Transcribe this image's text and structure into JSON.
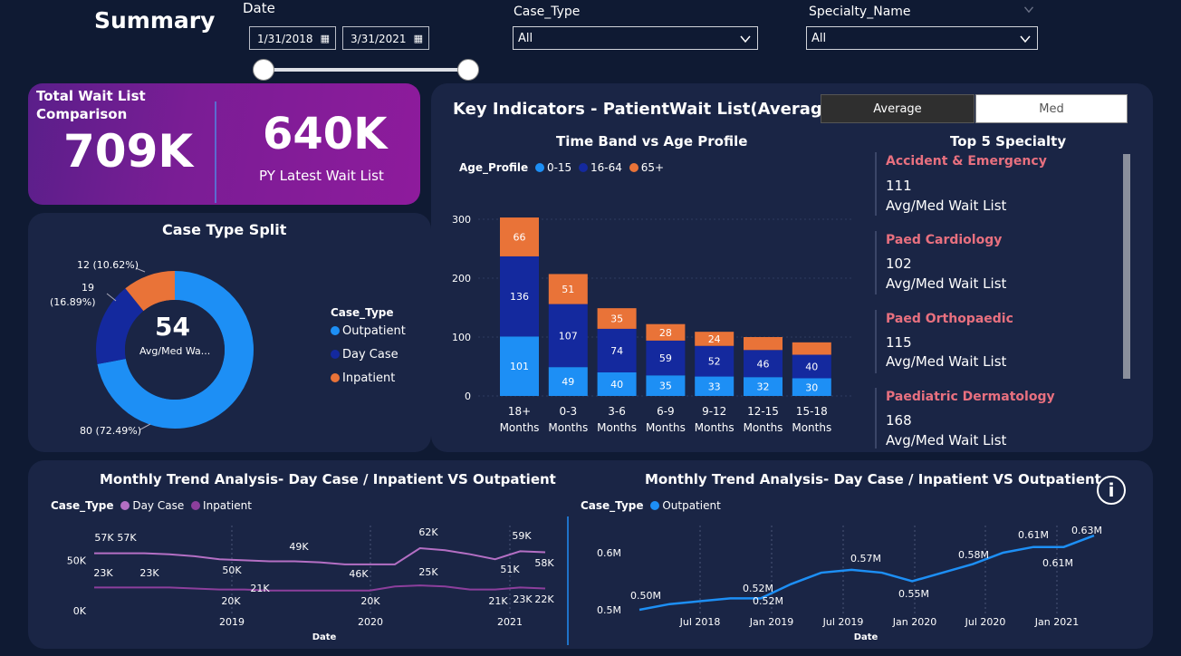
{
  "header": {
    "title": "Summary",
    "date_label": "Date",
    "date_start": "1/31/2018",
    "date_end": "3/31/2021",
    "case_type_label": "Case_Type",
    "case_type_value": "All",
    "specialty_label": "Specialty_Name",
    "specialty_value": "All"
  },
  "kpi": {
    "title_line1": "Total Wait List",
    "title_line2": "Comparison",
    "current_value": "709K",
    "py_value": "640K",
    "py_label": "PY Latest Wait List"
  },
  "toggle": {
    "average": "Average",
    "median": "Med"
  },
  "key_indicators_title": "Key Indicators - PatientWait List(Average)",
  "case_split": {
    "title": "Case Type Split",
    "center_value": "54",
    "center_label": "Avg/Med Wa...",
    "legend_title": "Case_Type",
    "labels": {
      "outpatient": "80 (72.49%)",
      "daycase_line1": "19",
      "daycase_line2": "(16.89%)",
      "inpatient": "12 (10.62%)"
    },
    "colors": {
      "outpatient": "#1d8ff5",
      "daycase": "#14299e",
      "inpatient": "#e97338"
    }
  },
  "time_band": {
    "title": "Time Band vs Age Profile",
    "legend_title": "Age_Profile",
    "y_ticks": [
      "300",
      "200",
      "100",
      "0"
    ],
    "colors": {
      "a": "#1d8ff5",
      "b": "#14299e",
      "c": "#e97338"
    }
  },
  "top5": {
    "title": "Top 5 Specialty",
    "items": [
      {
        "name": "Accident & Emergency",
        "value": "111",
        "label": "Avg/Med Wait List"
      },
      {
        "name": "Paed Cardiology",
        "value": "102",
        "label": "Avg/Med Wait List"
      },
      {
        "name": "Paed Orthopaedic",
        "value": "115",
        "label": "Avg/Med Wait List"
      },
      {
        "name": "Paediatric Dermatology",
        "value": "168",
        "label": "Avg/Med Wait List"
      }
    ]
  },
  "trend_left": {
    "title": "Monthly Trend Analysis- Day Case / Inpatient VS Outpatient",
    "legend_title": "Case_Type",
    "y_ticks": [
      "50K",
      "0K"
    ],
    "x_ticks": [
      "2019",
      "2020",
      "2021"
    ],
    "xlabel": "Date",
    "color_daycase": "#b46fc4",
    "color_inpatient": "#8c3f9c",
    "labels_upper": [
      "57K",
      "57K",
      "49K",
      "50K",
      "46K",
      "62K",
      "59K",
      "51K",
      "58K"
    ],
    "labels_lower": [
      "23K",
      "23K",
      "21K",
      "20K",
      "20K",
      "25K",
      "21K",
      "23K",
      "22K"
    ]
  },
  "trend_right": {
    "title": "Monthly Trend Analysis- Day Case / Inpatient VS Outpatient",
    "legend_title": "Case_Type",
    "y_ticks": [
      "0.6M",
      "0.5M"
    ],
    "x_ticks": [
      "Jul 2018",
      "Jan 2019",
      "Jul 2019",
      "Jan 2020",
      "Jul 2020",
      "Jan 2021"
    ],
    "xlabel": "Date",
    "color": "#1d8ff5",
    "labels": [
      "0.50M",
      "0.52M",
      "0.52M",
      "0.57M",
      "0.55M",
      "0.58M",
      "0.61M",
      "0.61M",
      "0.63M"
    ]
  },
  "info_icon": "i",
  "chart_data": [
    {
      "type": "bar",
      "title": "Time Band vs Age Profile",
      "categories": [
        "18+ Months",
        "0-3 Months",
        "3-6 Months",
        "6-9 Months",
        "9-12 Months",
        "12-15 Months",
        "15-18 Months"
      ],
      "series": [
        {
          "name": "0-15",
          "values": [
            101,
            49,
            40,
            35,
            33,
            32,
            30
          ]
        },
        {
          "name": "16-64",
          "values": [
            136,
            107,
            74,
            59,
            52,
            46,
            40
          ]
        },
        {
          "name": "65+",
          "values": [
            66,
            51,
            35,
            28,
            24,
            22,
            21
          ]
        }
      ],
      "ylim": [
        0,
        310
      ],
      "stacked": true,
      "legend": "top-left"
    },
    {
      "type": "pie",
      "title": "Case Type Split",
      "categories": [
        "Outpatient",
        "Day Case",
        "Inpatient"
      ],
      "values": [
        80,
        19,
        12
      ],
      "center_value": 54
    },
    {
      "type": "line",
      "title": "Monthly Trend Analysis- Day Case / Inpatient VS Outpatient",
      "x": [
        "2018-04",
        "2018-06",
        "2018-08",
        "2018-10",
        "2018-12",
        "2019-02",
        "2019-04",
        "2019-06",
        "2019-08",
        "2019-10",
        "2019-12",
        "2020-02",
        "2020-04",
        "2020-06",
        "2020-08",
        "2020-10",
        "2020-12",
        "2021-02",
        "2021-03"
      ],
      "series": [
        {
          "name": "Day Case",
          "values": [
            57,
            57,
            57,
            56,
            54,
            51,
            50,
            49,
            49,
            48,
            46,
            46,
            46,
            62,
            60,
            56,
            51,
            59,
            58
          ]
        },
        {
          "name": "Inpatient",
          "values": [
            23,
            23,
            23,
            23,
            22,
            21,
            21,
            20,
            20,
            20,
            20,
            20,
            24,
            25,
            24,
            21,
            21,
            23,
            22
          ]
        }
      ],
      "ylim": [
        0,
        80
      ],
      "xlabel": "Date"
    },
    {
      "type": "line",
      "title": "Monthly Trend Analysis- Day Case / Inpatient VS Outpatient",
      "x": [
        "2018-02",
        "2018-05",
        "2018-08",
        "2018-11",
        "2019-01",
        "2019-04",
        "2019-07",
        "2019-10",
        "2019-12",
        "2020-02",
        "2020-05",
        "2020-08",
        "2020-10",
        "2020-12",
        "2021-02",
        "2021-03"
      ],
      "series": [
        {
          "name": "Outpatient",
          "values": [
            0.5,
            0.51,
            0.515,
            0.52,
            0.52,
            0.545,
            0.565,
            0.57,
            0.565,
            0.55,
            0.565,
            0.58,
            0.6,
            0.61,
            0.61,
            0.63
          ]
        }
      ],
      "ylim": [
        0.48,
        0.66
      ],
      "xlabel": "Date"
    }
  ]
}
